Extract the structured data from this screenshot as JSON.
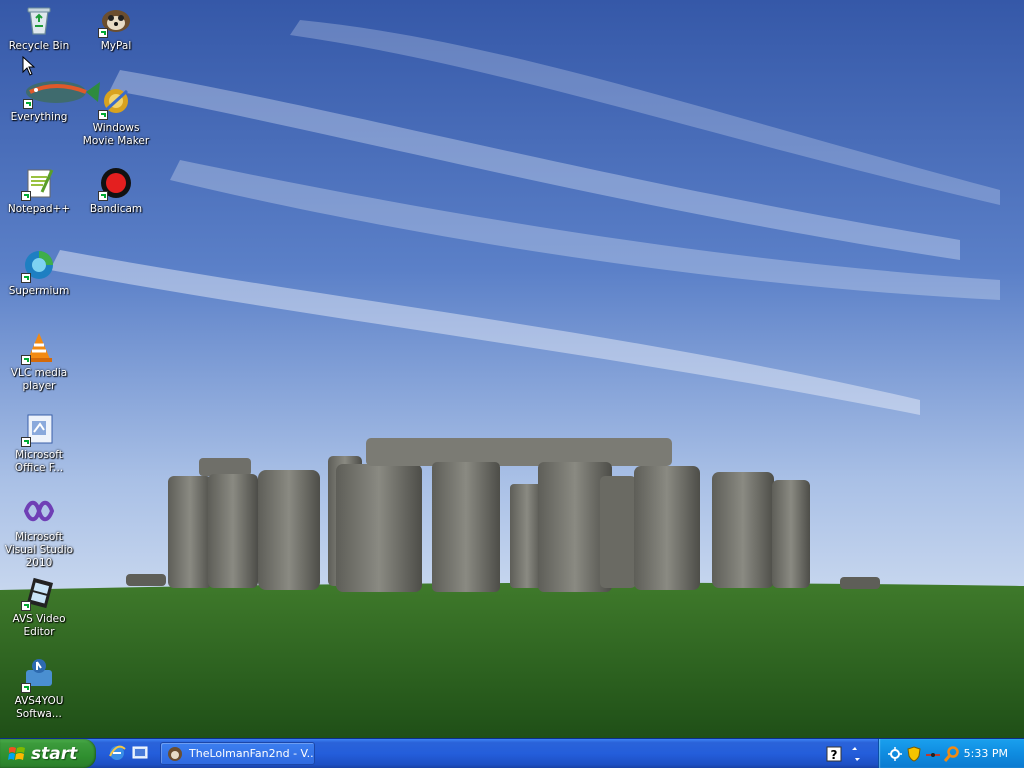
{
  "desktop": {
    "icons": [
      {
        "label": "Recycle Bin",
        "icon": "recycle-bin-icon"
      },
      {
        "label": "MyPal",
        "icon": "mypal-browser-icon"
      },
      {
        "label": "Everything",
        "icon": "everything-search-icon"
      },
      {
        "label": "Windows Movie Maker",
        "icon": "movie-maker-icon"
      },
      {
        "label": "Notepad++",
        "icon": "notepad-plus-plus-icon"
      },
      {
        "label": "Bandicam",
        "icon": "bandicam-icon"
      },
      {
        "label": "Supermium",
        "icon": "supermium-browser-icon"
      },
      {
        "label": "VLC media player",
        "icon": "vlc-cone-icon"
      },
      {
        "label": "Microsoft Office F...",
        "icon": "office-document-icon"
      },
      {
        "label": "Microsoft Visual Studio 2010",
        "icon": "visual-studio-icon"
      },
      {
        "label": "AVS Video Editor",
        "icon": "avs-video-editor-icon"
      },
      {
        "label": "AVS4YOU Softwa...",
        "icon": "avs4you-icon"
      }
    ]
  },
  "taskbar": {
    "start_label": "start",
    "quick_launch": [
      "internet-explorer-icon",
      "show-desktop-icon"
    ],
    "task_button_label": "TheLolmanFan2nd - V...",
    "language_icons": [
      "help-icon",
      "language-toggle-icon"
    ],
    "tray_icons": [
      "network-icon",
      "security-shield-icon",
      "connection-icon",
      "search-icon"
    ],
    "clock": "5:33 PM"
  },
  "colors": {
    "taskbar_blue": "#245edb",
    "start_green": "#2f8f2f",
    "tray_blue": "#0f8ce0"
  }
}
